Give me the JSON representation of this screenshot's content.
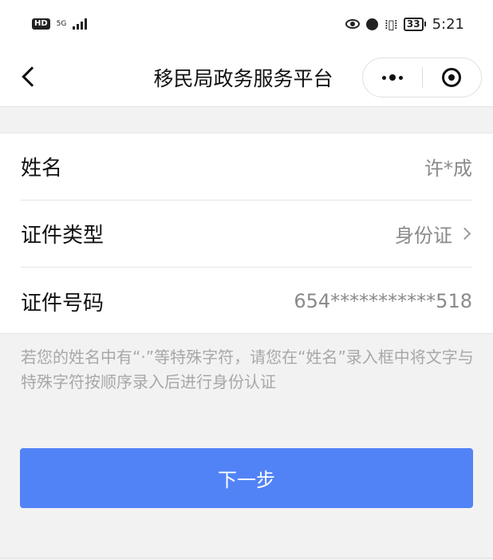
{
  "status_bar": {
    "hd": "HD",
    "network": "5G",
    "battery": "33",
    "time": "5:21"
  },
  "header": {
    "title": "移民局政务服务平台"
  },
  "form": {
    "name": {
      "label": "姓名",
      "value": "许*成"
    },
    "id_type": {
      "label": "证件类型",
      "value": "身份证"
    },
    "id_number": {
      "label": "证件号码",
      "value": "654***********518"
    }
  },
  "hint": "若您的姓名中有“·”等特殊字符，请您在“姓名”录入框中将文字与特殊字符按顺序录入后进行身份认证",
  "next_button": {
    "label": "下一步"
  },
  "colors": {
    "primary": "#5283f6",
    "background": "#f2f2f2",
    "hint_text": "#a8a8a8"
  },
  "icons": [
    "back-arrow-icon",
    "more-dots-icon",
    "target-close-icon",
    "chevron-right-icon",
    "eye-icon",
    "alarm-icon",
    "vibrate-icon"
  ]
}
